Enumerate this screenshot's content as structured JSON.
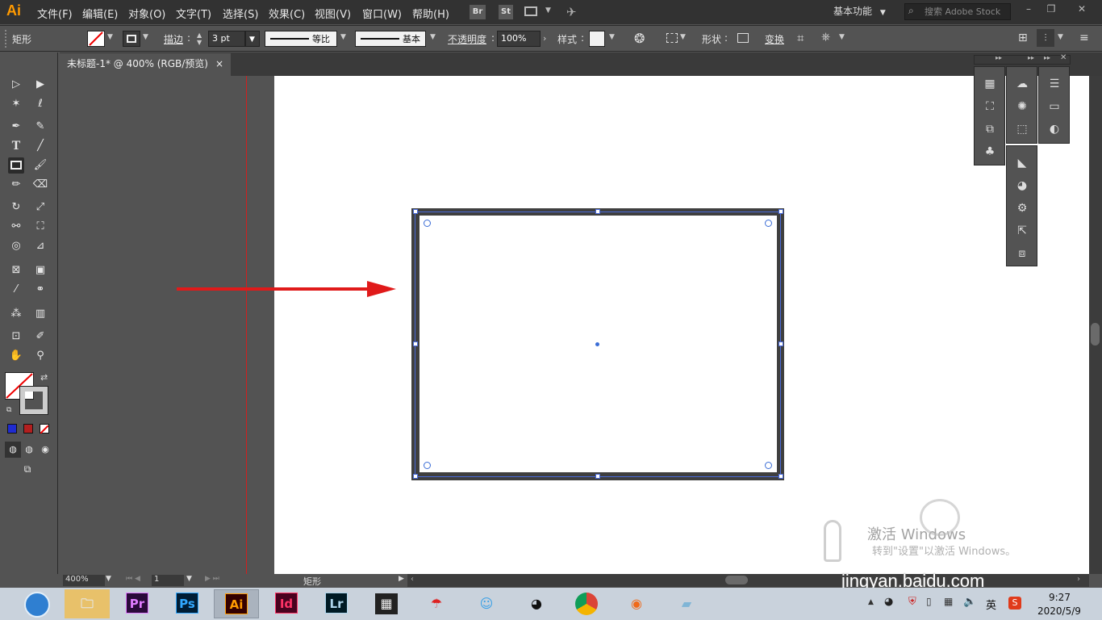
{
  "app": {
    "logo": "Ai",
    "accent": "#ff9a00"
  },
  "menu": [
    "文件(F)",
    "编辑(E)",
    "对象(O)",
    "文字(T)",
    "选择(S)",
    "效果(C)",
    "视图(V)",
    "窗口(W)",
    "帮助(H)"
  ],
  "bridge_buttons": [
    "Br",
    "St"
  ],
  "workspace": "基本功能",
  "search_placeholder": "搜索 Adobe Stock",
  "control": {
    "tool_name": "矩形",
    "stroke_label": "描边",
    "stroke_value": "3 pt",
    "profile_1": "等比",
    "profile_2": "基本",
    "opacity_label": "不透明度",
    "opacity_value": "100%",
    "style_label": "样式",
    "shape_label": "形状",
    "transform_label": "变换"
  },
  "document_tab": {
    "title": "未标题-1* @ 400% (RGB/预览)",
    "close": "×"
  },
  "status": {
    "zoom": "400%",
    "page": "1",
    "tool": "矩形"
  },
  "watermark": {
    "activate_title": "激活 Windows",
    "activate_sub": "转到\"设置\"以激活 Windows。",
    "site": "jingyan.baidu.com"
  },
  "taskbar": {
    "apps": [
      "Pr",
      "Ps",
      "Ai",
      "Id",
      "Lr"
    ],
    "time": "9:27",
    "date": "2020/5/9",
    "ime": "英"
  },
  "colors": {
    "arrow": "#e01a1a",
    "selection": "#4a6ad8",
    "stroke": "#3f3f3f"
  }
}
